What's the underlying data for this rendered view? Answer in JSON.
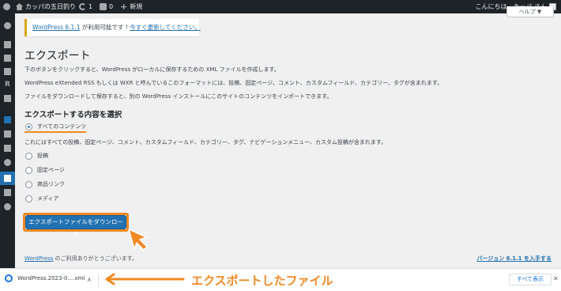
{
  "admin_bar": {
    "site_name": "カッパの五日釣り",
    "updates_count": "1",
    "comments_count": "0",
    "new_label": "新規",
    "greeting": "こんにちは、カッパ さん"
  },
  "screen_options_label": "ヘルプ ▼",
  "update_nag": {
    "version_link": "WordPress 6.1.1",
    "text": " が利用可能です ! ",
    "update_link": "今すぐ更新してください。"
  },
  "page_title": "エクスポート",
  "descriptions": [
    "下のボタンをクリックすると、WordPress がローカルに保存するための XML ファイルを作成します。",
    "WordPress eXtended RSS もしくは WXR と呼んでいるこのフォーマットには、投稿、固定ページ、コメント、カスタムフィールド、カテゴリー、タグが含まれます。",
    "ファイルをダウンロードして保存すると、別の WordPress インストールにこのサイトのコンテンツをインポートできます。"
  ],
  "section_title": "エクスポートする内容を選択",
  "options": {
    "all": "すべてのコンテンツ",
    "all_desc": "これにはすべての投稿、固定ページ、コメント、カスタムフィールド、カテゴリー、タグ、ナビゲーションメニュー、カスタム投稿が含まれます。",
    "posts": "投稿",
    "pages": "固定ページ",
    "links": "商品リンク",
    "media": "メディア"
  },
  "download_button": "エクスポートファイルをダウンロード",
  "footer": {
    "wp_link": "WordPress",
    "thanks": " のご利用ありがとうございます。",
    "version": "バージョン 6.1.1 を入手する"
  },
  "download_shelf": {
    "filename": "WordPress.2023-0....xml",
    "annotation": "エクスポートしたファイル",
    "show_all": "すべて表示"
  },
  "colors": {
    "accent": "#2271b1",
    "annotation": "#f08a24",
    "admin_bar": "#1d2327"
  }
}
